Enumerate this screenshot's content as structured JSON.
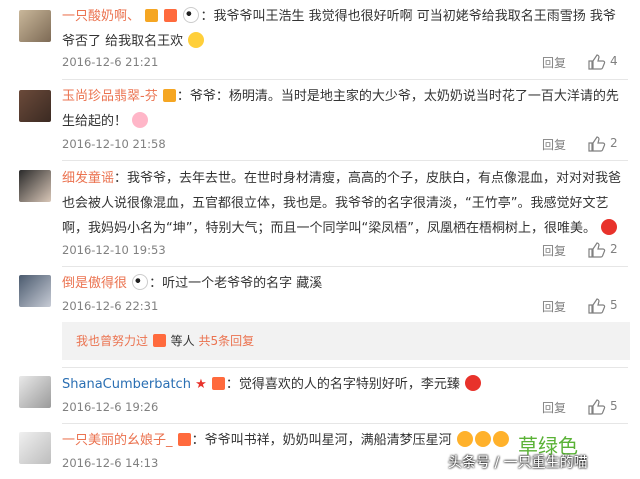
{
  "comments": [
    {
      "username": "一只酸奶啊、",
      "text_pre": "：我爷爷叫王浩生 我觉得也很好听啊 可当初姥爷给我取名王雨雪扬 我爷爷否了 给我取名王欢",
      "time": "2016-12-6 21:21",
      "reply": "回复",
      "likes": "4"
    },
    {
      "username": "玉尚珍品翡翠-芬",
      "text_pre": "：爷爷：杨明清。当时是地主家的大少爷，太奶奶说当时花了一百大洋请的先生给起的！",
      "time": "2016-12-10 21:58",
      "reply": "回复",
      "likes": "2"
    },
    {
      "username": "细发童谣",
      "text_pre": "：我爷爷，去年去世。在世时身材清瘦，高高的个子，皮肤白，有点像混血，对对对我爸也会被人说很像混血，五官都很立体，我也是。我爷爷的名字很清淡，“王竹亭”。我感觉好文艺啊，我妈妈小名为“坤”，特别大气；而且一个同学叫“梁凤梧”，凤凰栖在梧桐树上，很唯美。",
      "time": "2016-12-10 19:53",
      "reply": "回复",
      "likes": "2"
    },
    {
      "username": "倒是傲得很",
      "text_pre": "：听过一个老爷爷的名字 藏溪",
      "time": "2016-12-6 22:31",
      "reply": "回复",
      "likes": "5"
    },
    {
      "username": "ShanaCumberbatch",
      "text_pre": "：觉得喜欢的人的名字特别好听，李元臻",
      "time": "2016-12-6 19:26",
      "reply": "回复",
      "likes": "5"
    },
    {
      "username": "一只美丽的幺娘子_",
      "text_pre": "：爷爷叫书祥，奶奶叫星河，满船清梦压星河",
      "time": "2016-12-6 14:13",
      "reply": "回复",
      "likes": ""
    }
  ],
  "subreply": {
    "user": "我也曾努力过",
    "middle": "等人",
    "link": "共5条回复"
  },
  "watermark": {
    "green_text": "草绿色",
    "source": "头条号 / 一只重生的喵"
  },
  "colors": {
    "username": "#eb7350",
    "muted": "#808080",
    "accent_green": "#5ab236"
  },
  "icons": [
    "thumb-up-icon",
    "vip-badge-icon",
    "panda-emoji-icon",
    "heart-emoji-icon",
    "star-icon"
  ]
}
